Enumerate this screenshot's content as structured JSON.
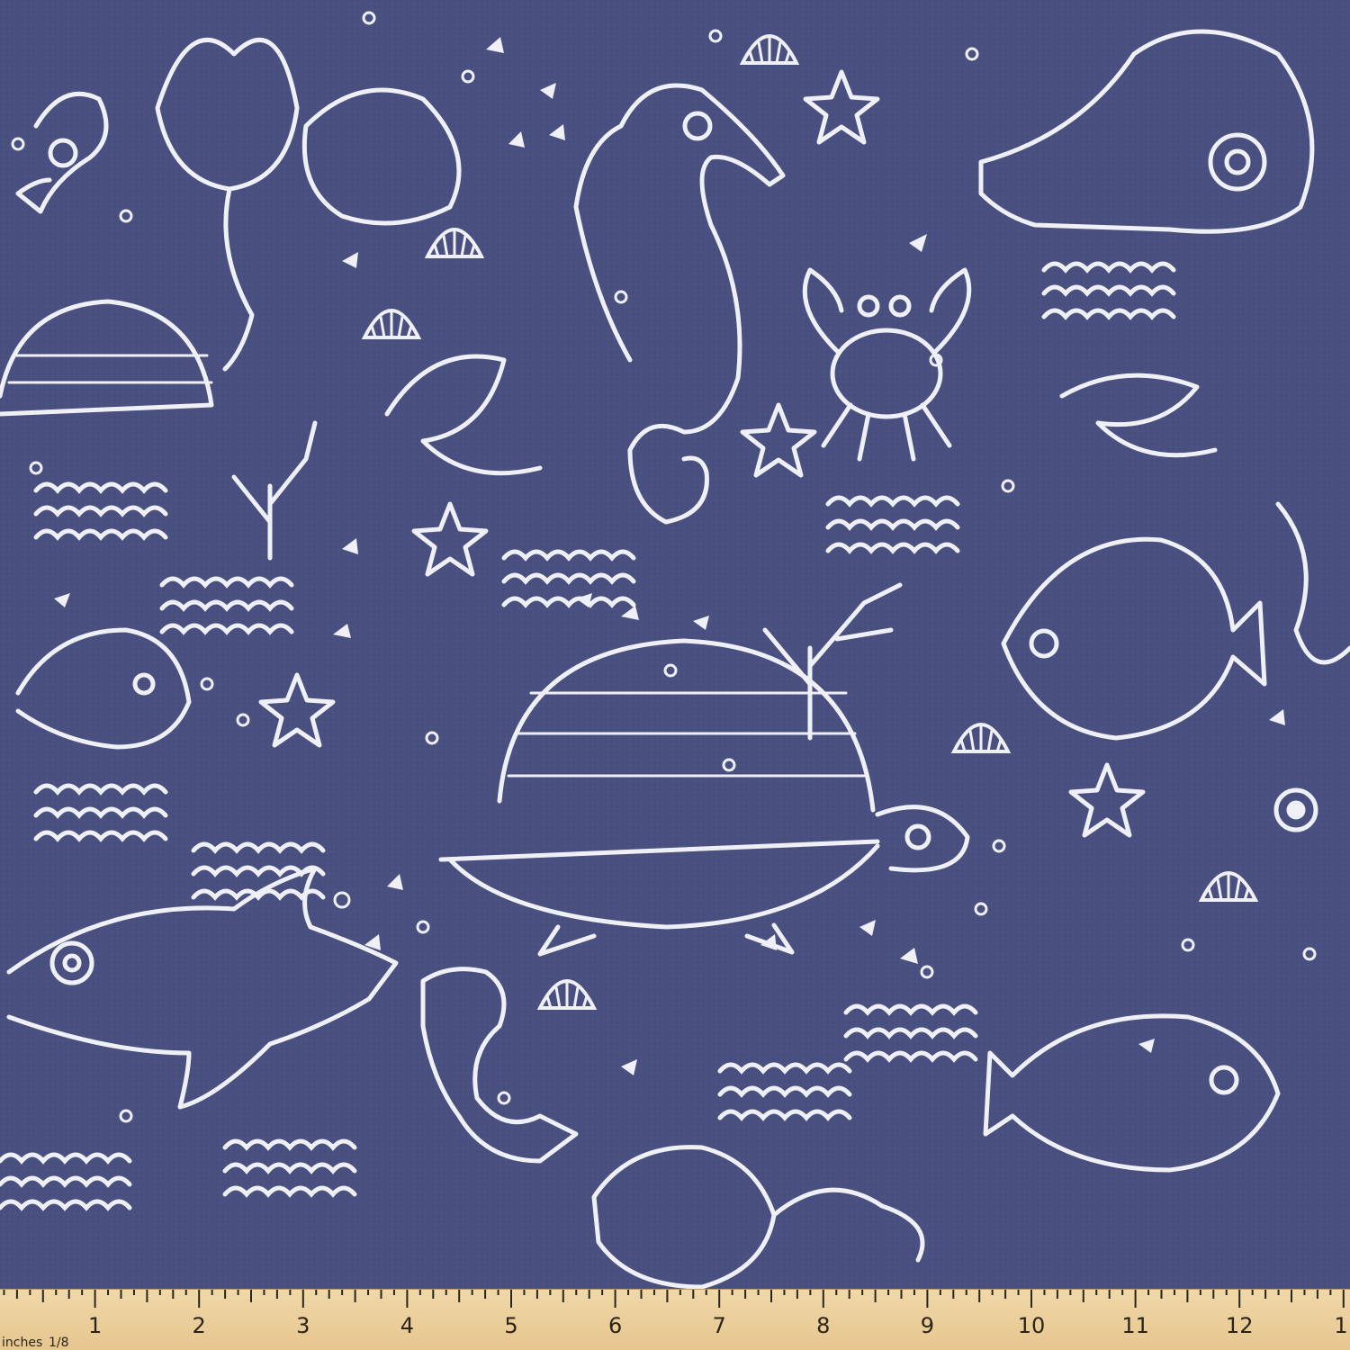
{
  "fabric": {
    "background_color": "#4a5080",
    "motif_color": "#eef0f6",
    "motifs": [
      "turtle",
      "seahorse",
      "crab",
      "whale",
      "fish",
      "starfish",
      "scorpion",
      "shark",
      "shell",
      "coral",
      "paisley-flower",
      "waves",
      "bubbles",
      "triangles"
    ]
  },
  "ruler": {
    "unit_label": "inches",
    "fraction_label": "1/8",
    "numbers": [
      "1",
      "2",
      "3",
      "4",
      "5",
      "6",
      "7",
      "8",
      "9",
      "10",
      "11",
      "12",
      "1"
    ],
    "background_color": "#ecd19f"
  }
}
